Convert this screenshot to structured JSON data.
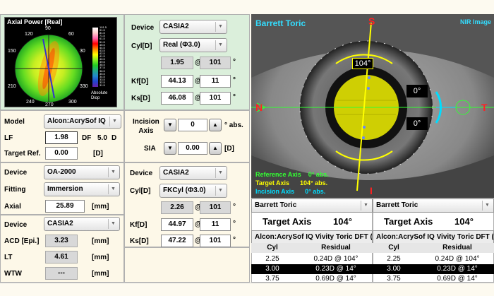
{
  "axial_map": {
    "title": "Axial Power [Real]",
    "scale_values": [
      "101.5",
      "91.5",
      "81.5",
      "71.5",
      "61.5",
      "51.5",
      "45.5",
      "44.5",
      "43.5",
      "42.5",
      "41.5",
      "40.5",
      "39.5",
      "38.5",
      "37.5",
      "36.5",
      "35.5",
      "34.5",
      "33.5",
      "32.5",
      "31.5"
    ],
    "scale_label": "Absolute\nDiop",
    "degree_labels": [
      "120",
      "90",
      "60",
      "150",
      "30",
      "210",
      "330",
      "240",
      "270",
      "300"
    ]
  },
  "cornea_top": {
    "device_label": "Device",
    "device_value": "CASIA2",
    "cyl_label": "Cyl[D]",
    "cyl_value": "Real (Φ3.0)",
    "cyl_power": "1.95",
    "cyl_axis": "101",
    "kf_label": "Kf[D]",
    "kf_value": "44.13",
    "kf_axis": "11",
    "ks_label": "Ks[D]",
    "ks_value": "46.08",
    "ks_axis": "101",
    "at": "@",
    "deg": "°"
  },
  "iol": {
    "model_label": "Model",
    "model_value": "Alcon:AcrySof IQ",
    "lf_label": "LF",
    "lf_value": "1.98",
    "df_label": "DF",
    "df_value": "5.0",
    "d_unit": "D",
    "target_label": "Target Ref.",
    "target_value": "0.00",
    "target_unit": "[D]"
  },
  "incision": {
    "axis_label": "Incision\nAxis",
    "axis_value": "0",
    "axis_unit": "° abs.",
    "sia_label": "SIA",
    "sia_value": "0.00",
    "sia_unit": "[D]",
    "down": "▼",
    "up": "▲"
  },
  "biometry": {
    "device_label": "Device",
    "device_value": "OA-2000",
    "fitting_label": "Fitting",
    "fitting_value": "Immersion",
    "axial_label": "Axial",
    "axial_value": "25.89",
    "axial_unit": "[mm]"
  },
  "cornea_bottom": {
    "device_label": "Device",
    "device_value": "CASIA2",
    "cyl_label": "Cyl[D]",
    "cyl_value": "FKCyl (Φ3.0)",
    "cyl_power": "2.26",
    "cyl_axis": "101",
    "kf_label": "Kf[D]",
    "kf_value": "44.97",
    "kf_axis": "11",
    "ks_label": "Ks[D]",
    "ks_value": "47.22",
    "ks_axis": "101",
    "at": "@",
    "deg": "°"
  },
  "anterior": {
    "device_label": "Device",
    "device_value": "CASIA2",
    "acd_label": "ACD [Epi.]",
    "acd_value": "3.23",
    "acd_unit": "[mm]",
    "lt_label": "LT",
    "lt_value": "4.61",
    "lt_unit": "[mm]",
    "wtw_label": "WTW",
    "wtw_value": "---",
    "wtw_unit": "[mm]"
  },
  "eye_image": {
    "title": "Barrett Toric",
    "mode": "NIR Image",
    "s": "S",
    "i": "I",
    "n": "N",
    "t": "T",
    "axis_badge": "104°",
    "badge_0a": "0°",
    "badge_0b": "0°",
    "legend_ref": "Reference Axis    0° abs.",
    "legend_target": "Target Axis      104° abs.",
    "legend_incision": "Incision Axis      0° abs.",
    "colors": {
      "reference": "#33ff33",
      "target": "#ffff00",
      "incision": "#00ddff"
    }
  },
  "result_left": {
    "selector": "Barrett Toric",
    "target_label": "Target Axis",
    "target_value": "104°",
    "lens": "Alcon:AcrySof IQ Vivity Toric DFT (",
    "col_cyl": "Cyl",
    "col_res": "Residual",
    "rows": [
      {
        "cyl": "2.25",
        "res": "0.24D @ 104°"
      },
      {
        "cyl": "3.00",
        "res": "0.23D @ 14°"
      },
      {
        "cyl": "3.75",
        "res": "0.69D @ 14°"
      }
    ]
  },
  "result_right": {
    "selector": "Barrett Toric",
    "target_label": "Target Axis",
    "target_value": "104°",
    "lens": "Alcon:AcrySof IQ Vivity Toric DFT (",
    "col_cyl": "Cyl",
    "col_res": "Residual",
    "rows": [
      {
        "cyl": "2.25",
        "res": "0.24D @ 104°"
      },
      {
        "cyl": "3.00",
        "res": "0.23D @ 14°"
      },
      {
        "cyl": "3.75",
        "res": "0.69D @ 14°"
      }
    ]
  }
}
